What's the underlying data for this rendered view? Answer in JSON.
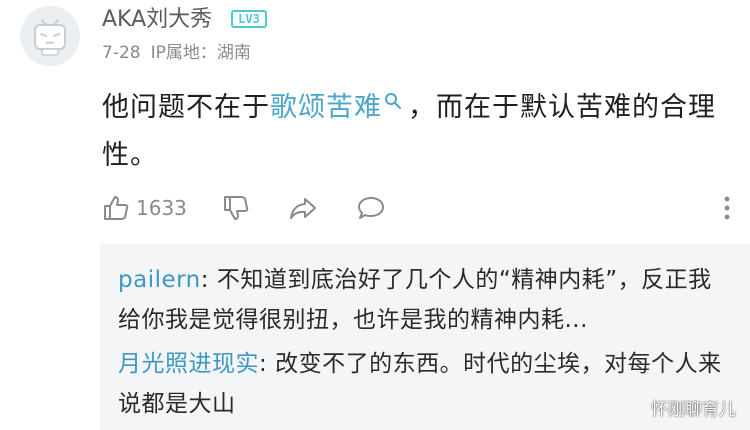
{
  "comment": {
    "username": "AKA刘大秀",
    "level_badge": "LV3",
    "date": "7-28",
    "ip_location": "IP属地：湖南",
    "text_before": "他问题不在于",
    "link_text": "歌颂苦难",
    "text_after": "，而在于默认苦难的合理性。",
    "like_count": "1633"
  },
  "icons": {
    "avatar": "tv-mascot-icon",
    "like": "thumbs-up-icon",
    "dislike": "thumbs-down-icon",
    "share": "share-arrow-icon",
    "reply": "speech-bubble-icon",
    "more": "more-vertical-icon",
    "link_search": "search-icon"
  },
  "replies": [
    {
      "author": "pailern",
      "separator": ": ",
      "text": "不知道到底治好了几个人的“精神内耗”，反正我给你我是觉得很别扭，也许是我的精神内耗..."
    },
    {
      "author": "月光照进现实",
      "separator": ": ",
      "text": "改变不了的东西。时代的尘埃，对每个人来说都是大山"
    }
  ],
  "watermark": "怀刚聊育儿",
  "colors": {
    "link": "#4aa7c9",
    "reply_author": "#3d97c4",
    "badge": "#4ec9d4",
    "meta": "#8a8a8a",
    "reply_bg": "#f4f5f7"
  }
}
